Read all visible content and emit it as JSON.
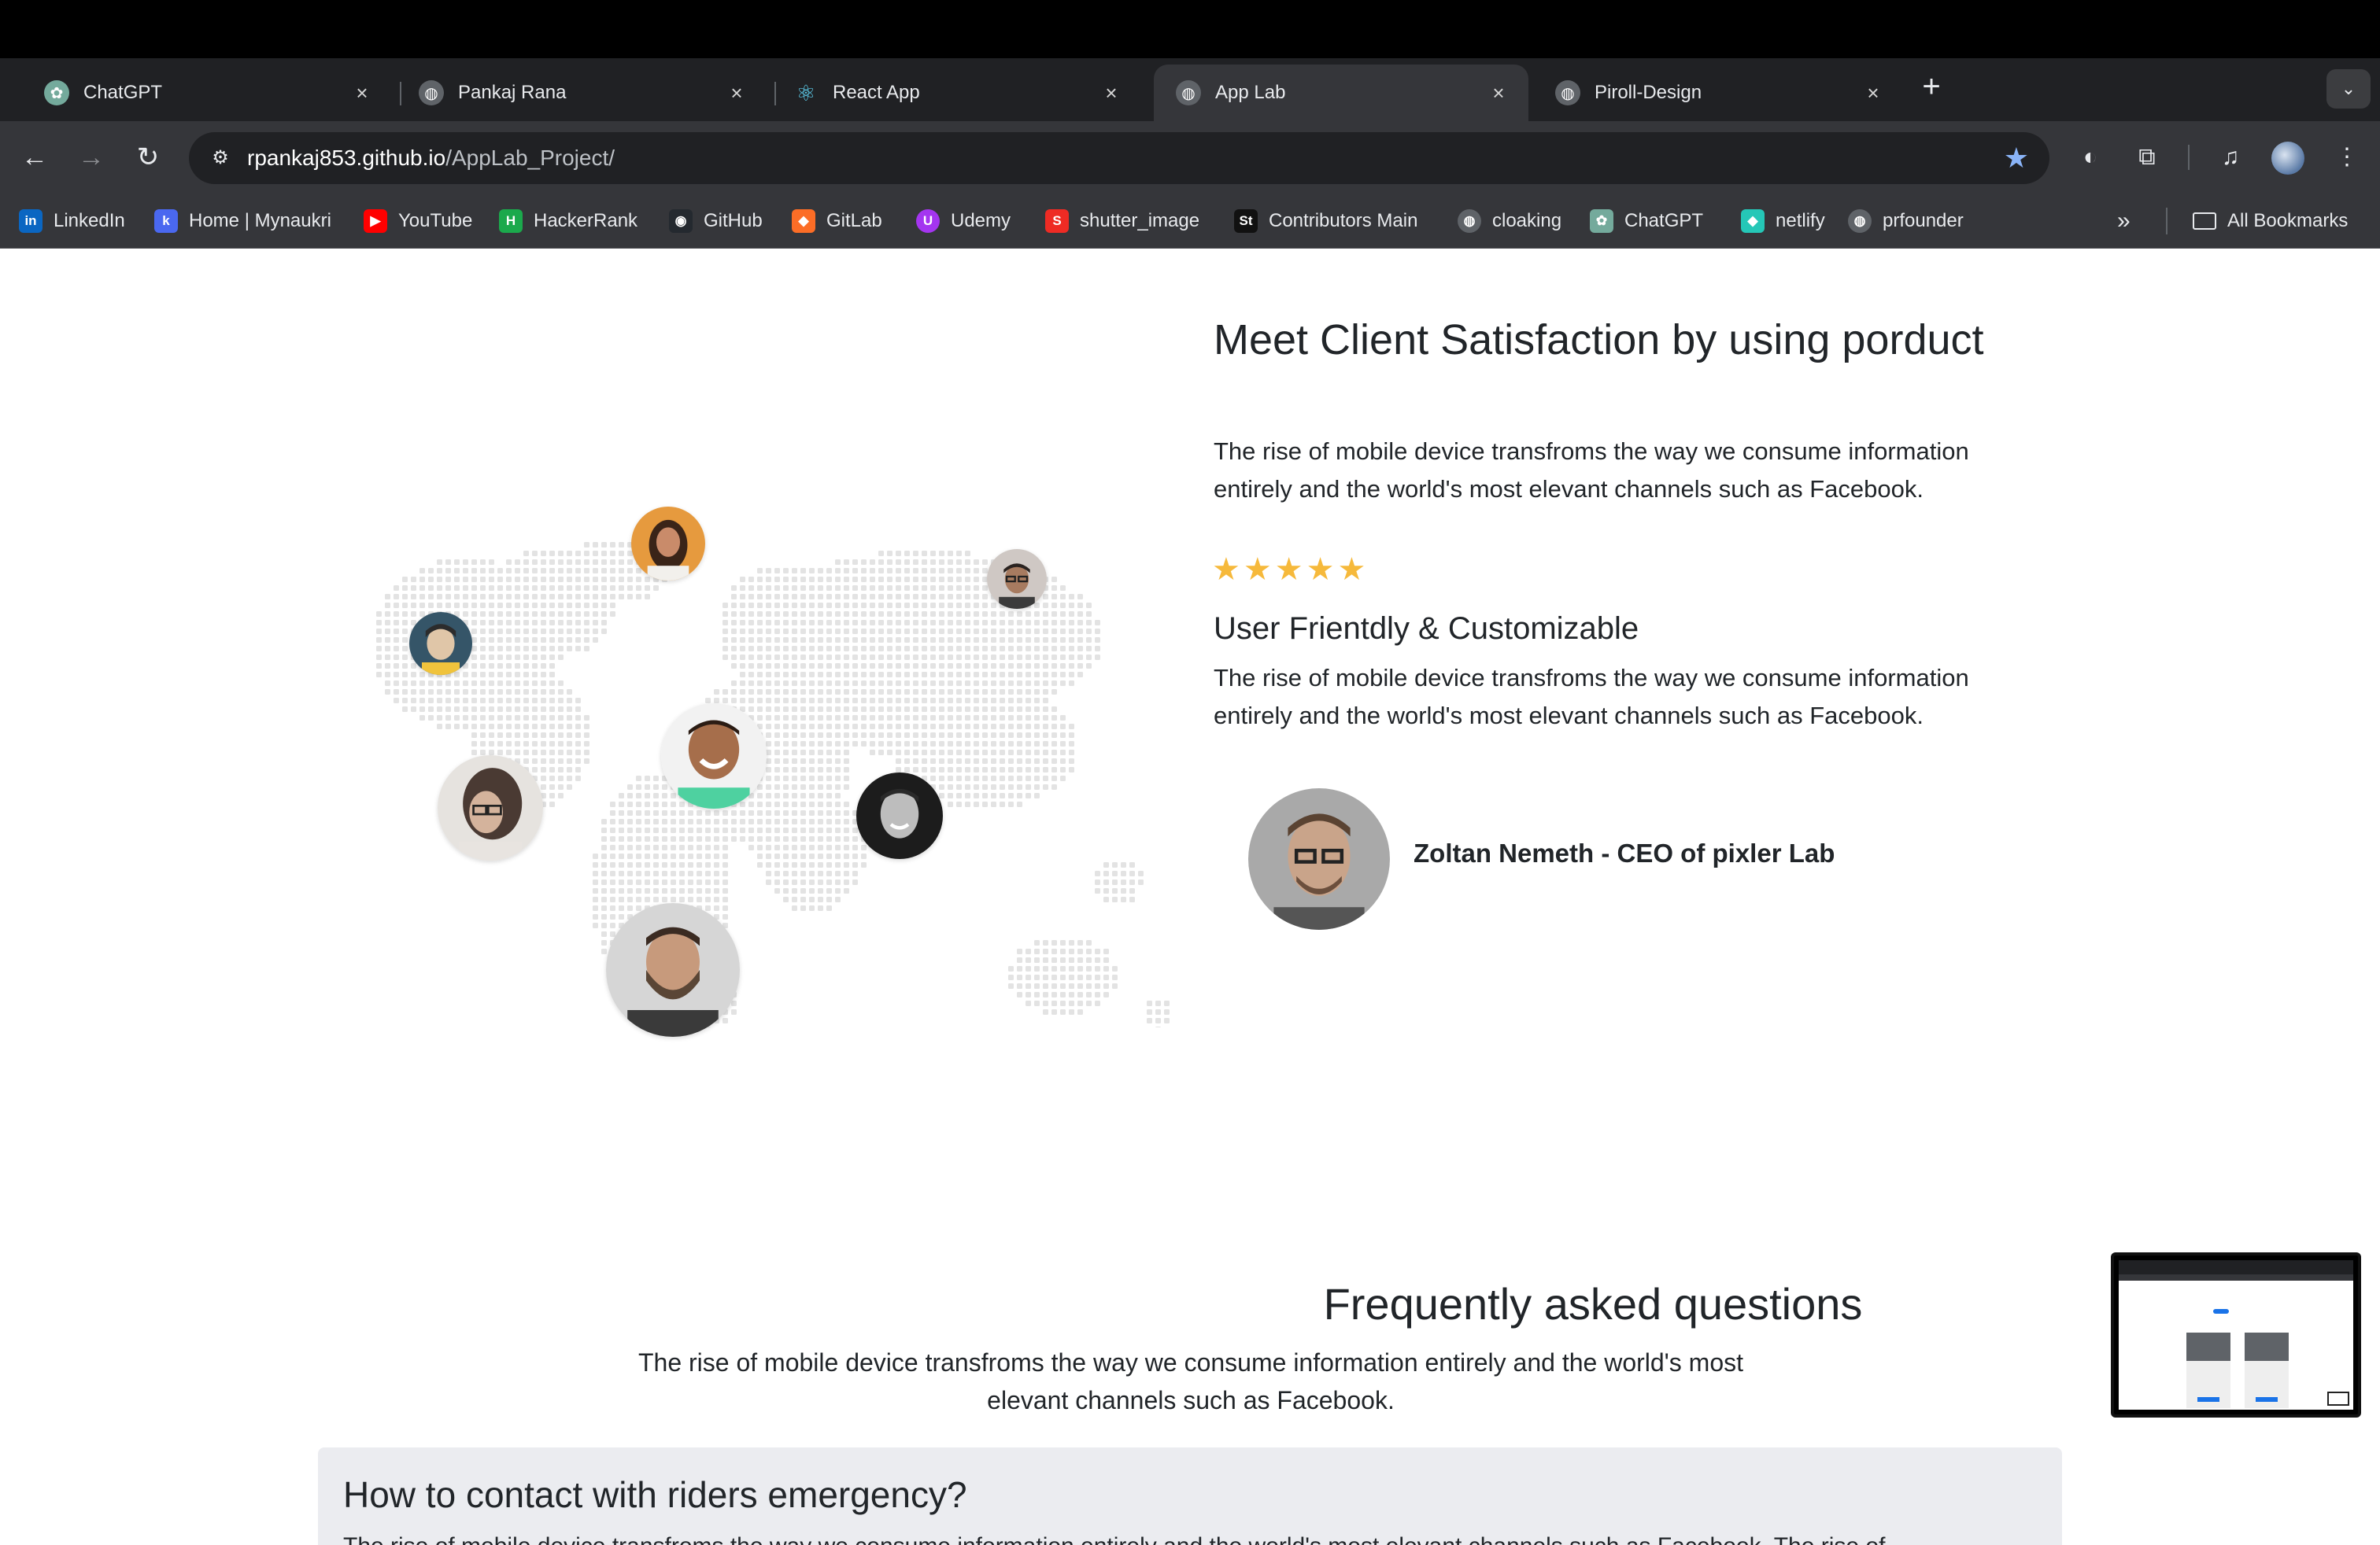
{
  "browser": {
    "tabs": [
      {
        "label": "ChatGPT",
        "icon": "chatgpt-icon"
      },
      {
        "label": "Pankaj Rana",
        "icon": "globe-icon"
      },
      {
        "label": "React App",
        "icon": "react-icon"
      },
      {
        "label": "App Lab",
        "icon": "globe-icon",
        "active": true
      },
      {
        "label": "Piroll-Design",
        "icon": "globe-icon"
      }
    ],
    "url_host": "rpankaj853.github.io",
    "url_path": "/AppLab_Project/",
    "bookmarks": [
      {
        "label": "LinkedIn",
        "icon": "linkedin-icon",
        "color": "#0a66c2",
        "glyph": "in"
      },
      {
        "label": "Home | Mynaukri",
        "icon": "mynaukri-icon",
        "color": "#4a68f0",
        "glyph": "k"
      },
      {
        "label": "YouTube",
        "icon": "youtube-icon",
        "color": "#ff0000",
        "glyph": "▶"
      },
      {
        "label": "HackerRank",
        "icon": "hackerrank-icon",
        "color": "#1ba94c",
        "glyph": "H"
      },
      {
        "label": "GitHub",
        "icon": "github-icon",
        "color": "#24292f",
        "glyph": "◉"
      },
      {
        "label": "GitLab",
        "icon": "gitlab-icon",
        "color": "#fc6d26",
        "glyph": "◆"
      },
      {
        "label": "Udemy",
        "icon": "udemy-icon",
        "color": "#a435f0",
        "glyph": "U"
      },
      {
        "label": "shutter_image",
        "icon": "shutterstock-icon",
        "color": "#ee2b24",
        "glyph": "S"
      },
      {
        "label": "Contributors Main",
        "icon": "shutterstock-contributors-icon",
        "color": "#111111",
        "glyph": "St"
      },
      {
        "label": "cloaking",
        "icon": "globe-icon",
        "color": "#5f6368",
        "glyph": "◍"
      },
      {
        "label": "ChatGPT",
        "icon": "chatgpt-icon",
        "color": "#74aa9c",
        "glyph": "✿"
      },
      {
        "label": "netlify",
        "icon": "netlify-icon",
        "color": "#25c7b7",
        "glyph": "◆"
      },
      {
        "label": "prfounder",
        "icon": "globe-icon",
        "color": "#5f6368",
        "glyph": "◍"
      }
    ],
    "all_bookmarks": "All Bookmarks"
  },
  "section_satisfaction": {
    "heading": "Meet Client Satisfaction by using porduct",
    "paragraph1": "The rise of mobile device transfroms the way we consume information entirely and the world's most elevant channels such as Facebook.",
    "rating_stars": 5,
    "subheading": "User Frientdly & Customizable",
    "paragraph2": "The rise of mobile device transfroms the way we consume information entirely and the world's most elevant channels such as Facebook.",
    "testimonial_name": "Zoltan Nemeth - CEO of pixler Lab"
  },
  "faq": {
    "title": "Frequently asked questions",
    "subtitle": "The rise of mobile device transfroms the way we consume information entirely and the world's most elevant channels such as Facebook.",
    "items": [
      {
        "question": "How to contact with riders emergency?",
        "answer": "The rise of mobile device transfroms the way we consume information entirely and the world's most elevant channels such as Facebook. The rise of"
      }
    ]
  },
  "colors": {
    "star": "#f6b93b",
    "faq_card_bg": "#ebecf0",
    "bookmark_star": "#8ab4f8"
  }
}
